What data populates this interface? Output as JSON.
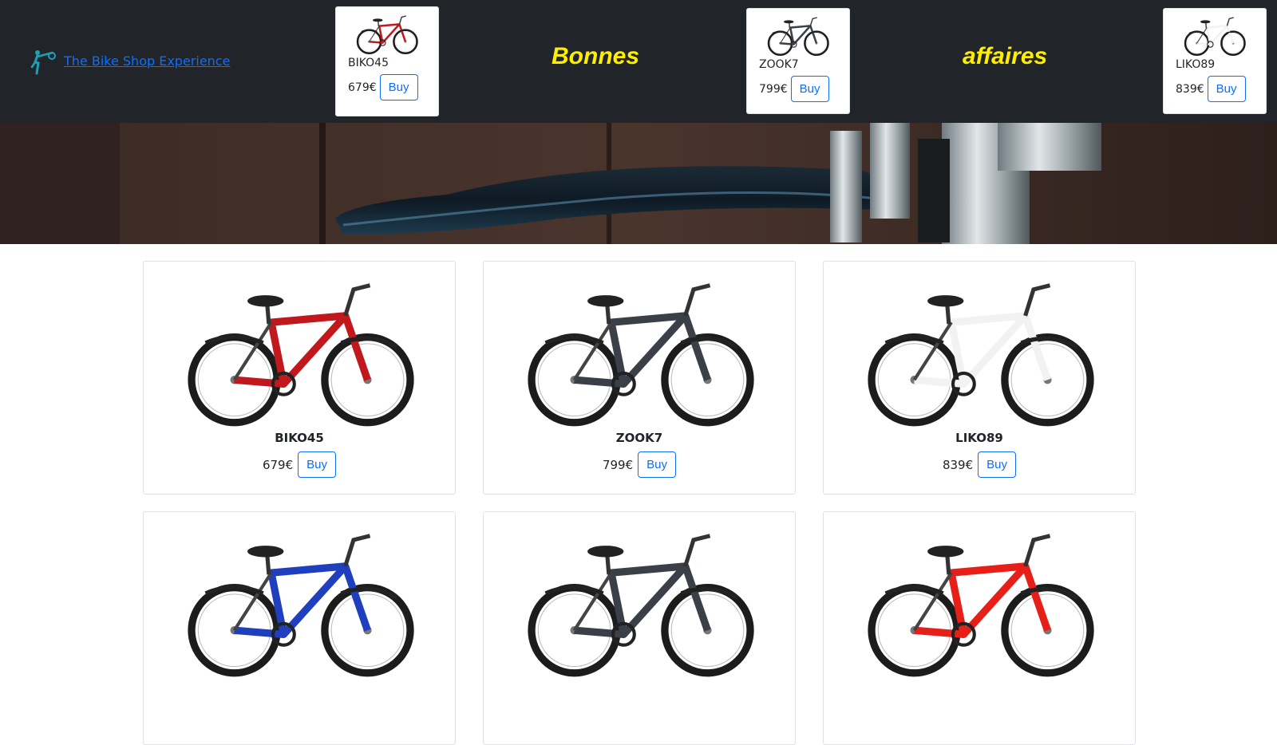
{
  "header": {
    "brand_label": "The Bike Shop Experience",
    "promo_word_1": "Bonnes",
    "promo_word_2": "affaires",
    "deals": [
      {
        "name": "BIKO45",
        "price": "679€",
        "buy": "Buy",
        "frame_color": "#c0181d"
      },
      {
        "name": "ZOOK7",
        "price": "799€",
        "buy": "Buy",
        "frame_color": "#3a3f48"
      },
      {
        "name": "LIKO89",
        "price": "839€",
        "buy": "Buy",
        "frame_color": "#f2f2f2"
      }
    ]
  },
  "products": [
    {
      "name": "BIKO45",
      "price": "679€",
      "buy": "Buy",
      "frame_color": "#c0181d"
    },
    {
      "name": "ZOOK7",
      "price": "799€",
      "buy": "Buy",
      "frame_color": "#3a3f48"
    },
    {
      "name": "LIKO89",
      "price": "839€",
      "buy": "Buy",
      "frame_color": "#f2f2f2"
    },
    {
      "frame_color": "#1f3fbf"
    },
    {
      "frame_color": "#3a3f48"
    },
    {
      "frame_color": "#e62019"
    }
  ],
  "colors": {
    "topbar_bg": "#212529",
    "promo_text": "#ffee00",
    "link": "#0d6efd",
    "button_outline": "#0d6efd"
  },
  "icons": {
    "brand_logo": "kick-scooter-rider-icon"
  }
}
